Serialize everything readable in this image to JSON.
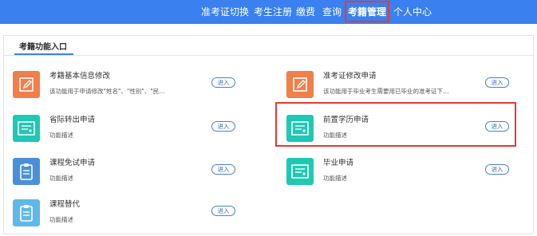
{
  "nav": {
    "items": [
      {
        "label": "准考证切换"
      },
      {
        "label": "考生注册"
      },
      {
        "label": "缴费"
      },
      {
        "label": "查询"
      },
      {
        "label": "考籍管理"
      },
      {
        "label": "个人中心"
      }
    ],
    "active_index": 4
  },
  "section": {
    "title": "考籍功能入口"
  },
  "cards": [
    {
      "title": "考籍基本信息修改",
      "desc": "该功能用于申请修改\"姓名\"、\"性别\"、\"民...",
      "button": "进入",
      "icon": "edit-icon",
      "icon_color": "#f07f49"
    },
    {
      "title": "准考证修改申请",
      "desc": "该功能用于毕业考生需要用已毕业的准考证下的...",
      "button": "进入",
      "icon": "edit-icon",
      "icon_color": "#f07f49"
    },
    {
      "title": "省际转出申请",
      "desc": "功能描述",
      "button": "进入",
      "icon": "certificate-icon",
      "icon_color": "#1ec9b4"
    },
    {
      "title": "前置学历申请",
      "desc": "功能描述",
      "button": "进入",
      "icon": "certificate-icon",
      "icon_color": "#1ec9b4"
    },
    {
      "title": "课程免试申请",
      "desc": "功能描述",
      "button": "进入",
      "icon": "clipboard-icon",
      "icon_color": "#4a90d9"
    },
    {
      "title": "毕业申请",
      "desc": "功能描述",
      "button": "进入",
      "icon": "certificate-icon",
      "icon_color": "#1ec9b4"
    },
    {
      "title": "课程替代",
      "desc": "功能描述",
      "button": "进入",
      "icon": "clipboard-icon",
      "icon_color": "#5fb8e8"
    }
  ],
  "colors": {
    "nav_bg": "#3a80ee",
    "highlight": "#e53935",
    "accent": "#3a80ee"
  }
}
